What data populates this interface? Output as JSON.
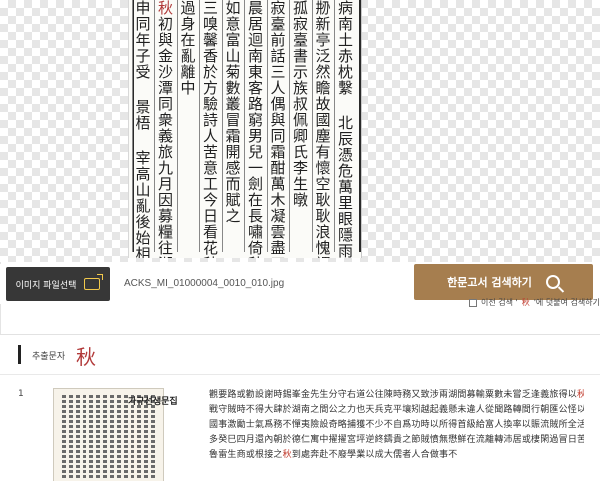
{
  "preview": {
    "columns": [
      {
        "text": "病南土赤枕繫 北辰憑危萬里眼隱雨九秋身",
        "small": false
      },
      {
        "text": "刱新亭泛然瞻故國塵有懷空耿耿浪愧謂纓人",
        "small": false
      },
      {
        "text": "孤寂臺書示族叔佩卿氏李生暾",
        "small": false
      },
      {
        "text": "寂臺前話三人偶與同霜酣萬木凝雲盡四山空北",
        "small": false
      },
      {
        "text": "晨居迴南東客路窮男兒一劍在長嘯倚秋風",
        "small": false
      },
      {
        "text": "如意富山菊數叢冒霜開感而賦之",
        "small": false
      },
      {
        "text": "三嗅馨香於方驗詩人苦意工今日看花秋又暮",
        "small": false
      },
      {
        "text": "過身在亂離中",
        "small": false
      },
      {
        "text": "秋初與金沙潭同衆義旅九月因募糧往湖界",
        "small": false,
        "highlight": 0
      },
      {
        "text": "申同年子受 景梧 宰高山亂後始相遇不覺悲",
        "small": false
      }
    ]
  },
  "toolbar": {
    "file_button_label": "이미지 파일선택",
    "file_name": "ACKS_MI_01000004_0010_010.jpg",
    "search_button_label": "한문고서 검색하기",
    "reuse_prefix": "이전 검색 '",
    "reuse_char": "秋",
    "reuse_suffix": "'에 덧붙여 검색하기"
  },
  "extract": {
    "label": "추출문자",
    "character": "秋"
  },
  "results": [
    {
      "number": "1",
      "title": "가규선생문집",
      "lines": [
        {
          "pre": "觀要路或勸設謝時錫峯金先生分守右道公往陳時務又致涉兩湖間募輸粟數未嘗乏逢義旅得以",
          "hit": "秋",
          "post": ""
        },
        {
          "pre": "戰守賊時不得大肆於湖南之間公之力也天兵克平壤矧越起義懸未違人從聞路轉間行朝匯公怪以妻揮",
          "hit": "",
          "post": ""
        },
        {
          "pre": "國事激勵士氣爲務不憚夷險設奇略捕獲不少不自爲功時以所得首級給富人換率以賑流賊所全活亦",
          "hit": "",
          "post": ""
        },
        {
          "pre": "多癸巳四月還內朝於德仁寓中擢擢宮坪逆終鑄貴之節賊憤無懋鮮在流離轉沛居",
          "hit": "",
          "post": "或棲閑過冒日苦許"
        },
        {
          "pre": "魯雷生商或根接之",
          "hit": "秋",
          "post": "到處奔赴不廢學業以成大儒者人合做事不"
        }
      ]
    }
  ],
  "colors": {
    "file_button_bg": "#373737",
    "search_button_bg": "#a67e4f",
    "highlight": "#c0392b"
  }
}
